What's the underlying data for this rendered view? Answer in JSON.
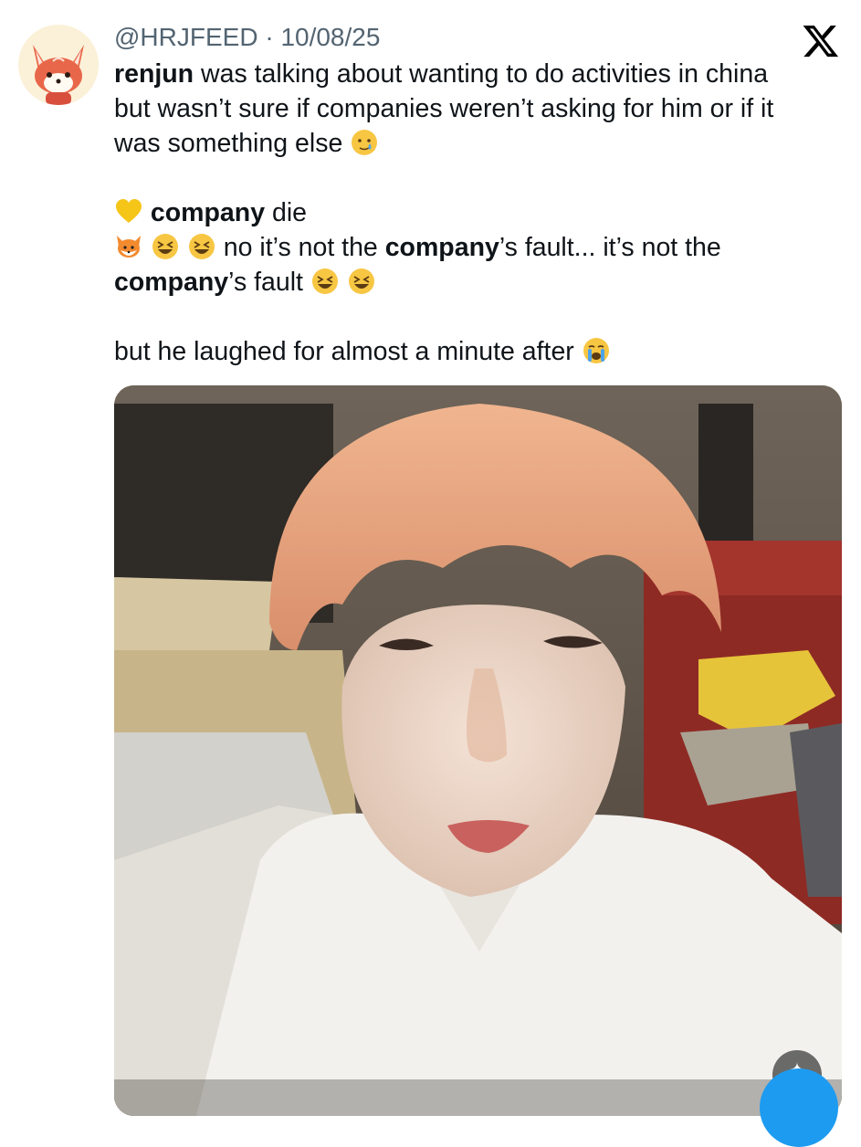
{
  "tweet": {
    "handle": "@HRJFEED",
    "separator": "·",
    "date": "10/08/25",
    "line1_bold": "renjun",
    "line1_rest": " was talking about wanting to do activities in china",
    "line2": "but wasn’t sure if companies weren’t asking for him or if it",
    "line3": "was something else",
    "l5_bold": "company",
    "l5_rest": " die",
    "l6_pre": " no it’s not the ",
    "l6_bold": "company",
    "l6_post": "’s fault... it’s not the",
    "l7_bold": "company",
    "l7_post": "’s fault",
    "l9": "but he laughed for almost a minute after"
  },
  "icons": {
    "avatar": "fox-avatar-icon",
    "brand": "x-logo-icon",
    "crying": "sad-tear-emoji-icon",
    "heart": "yellow-heart-emoji-icon",
    "fox": "fox-emoji-icon",
    "laughing": "laughing-emoji-icon",
    "sobbing": "sobbing-emoji-icon"
  },
  "colors": {
    "text": "#0f1419",
    "muted": "#536471",
    "accent": "#1d9bf0"
  }
}
